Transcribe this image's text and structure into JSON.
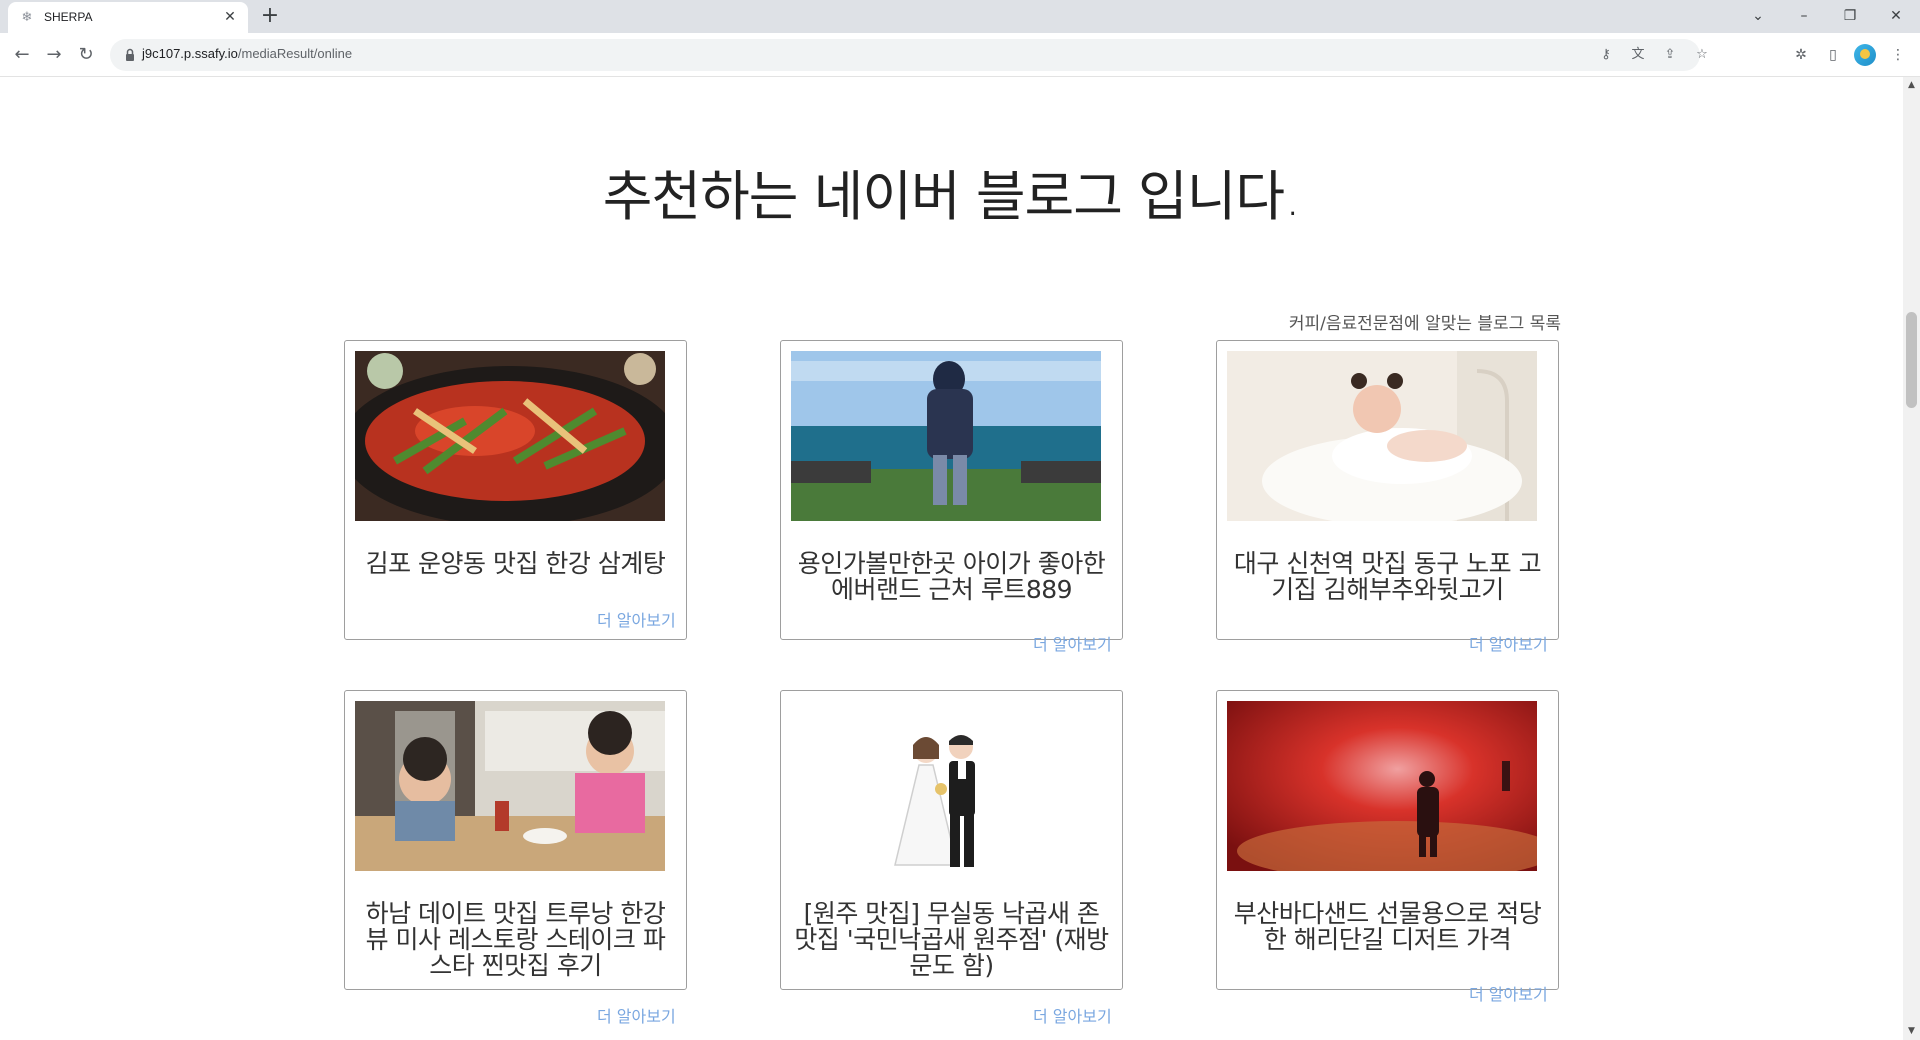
{
  "browser": {
    "tab_title": "SHERPA",
    "url_host": "j9c107.p.ssafy.io",
    "url_path": "/mediaResult/online"
  },
  "page": {
    "title": "추천하는 네이버 블로그 입니다.",
    "list_caption": "커피/음료전문점에 알맞는 블로그 목록",
    "more_label": "더 알아보기",
    "cards": [
      {
        "title": "김포 운양동 맛집 한강 삼계탕",
        "image": "food-photo"
      },
      {
        "title": "용인가볼만한곳 아이가 좋아한 에버랜드 근처 루트889",
        "image": "sea-view-photo"
      },
      {
        "title": "대구 신천역 맛집 동구 노포 고기집 김해부추와뒷고기",
        "image": "baby-photo"
      },
      {
        "title": "하남 데이트 맛집 트루낭 한강뷰 미사 레스토랑 스테이크 파스타 찐맛집 후기",
        "image": "family-dining-photo"
      },
      {
        "title": "[원주 맛집] 무실동 낙곱새 존맛집 '국민낙곱새 원주점' (재방문도 함)",
        "image": "wedding-couple-illustration"
      },
      {
        "title": "부산바다샌드 선물용으로 적당한 해리단길 디저트 가격",
        "image": "red-tunnel-photo"
      }
    ]
  }
}
